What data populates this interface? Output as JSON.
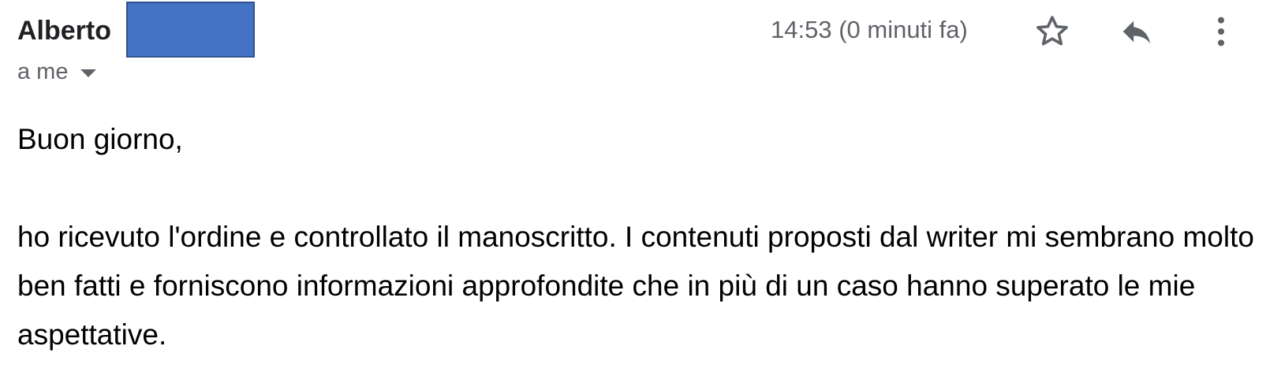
{
  "email": {
    "sender_name": "Alberto",
    "recipient_label": "a me",
    "timestamp": "14:53 (0 minuti fa)",
    "icons": {
      "star": "star-outline-icon",
      "reply": "reply-icon",
      "more": "more-vertical-icon",
      "recipient_details": "caret-down-icon"
    },
    "body": {
      "greeting": "Buon giorno,",
      "paragraph": "ho ricevuto l'ordine e controllato il manoscritto. I contenuti proposti dal writer mi sembrano molto ben fatti e forniscono informazioni approfondite che in più di un caso hanno superato le mie aspettative."
    },
    "colors": {
      "redaction_fill": "#4472c4",
      "secondary_text": "#5f6368"
    }
  }
}
